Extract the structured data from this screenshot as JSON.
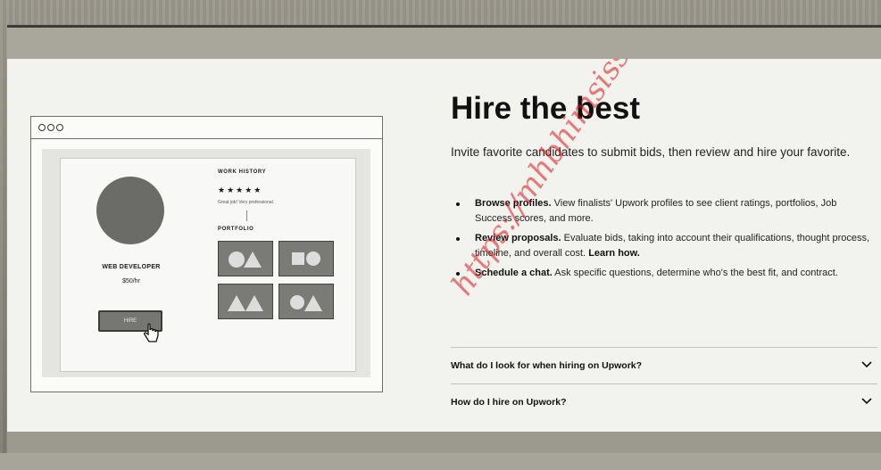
{
  "heading": "Hire the best",
  "intro": "Invite favorite candidates to submit bids, then review and hire your favorite.",
  "bullets": [
    {
      "bold": "Browse profiles.",
      "text": " View finalists' Upwork profiles to see client ratings, portfolios, Job Success scores, and more."
    },
    {
      "bold": "Review proposals.",
      "text": " Evaluate bids, taking into account their qualifications, thought process, timeline, and overall cost.",
      "link": "Learn how."
    },
    {
      "bold": "Schedule a chat.",
      "text": " Ask specific questions, determine who's the best fit, and contract."
    }
  ],
  "faqs": [
    {
      "question": "What do I look for when hiring on Upwork?",
      "icon": "chevron-down-icon"
    },
    {
      "question": "How do I hire on Upwork?",
      "icon": "chevron-down-icon"
    }
  ],
  "mockup": {
    "role": "WEB DEVELOPER",
    "rate": "$50/hr",
    "hire_button": "HIRE",
    "work_history_title": "WORK HISTORY",
    "stars": "★★★★★",
    "review": "Great job! Very professional.",
    "portfolio_title": "PORTFOLIO"
  },
  "watermark": "https://mhbhimsissel",
  "colors": {
    "watermark": "#dc1414",
    "panel": "#f2f2ef",
    "avatar": "#6b6b68"
  }
}
